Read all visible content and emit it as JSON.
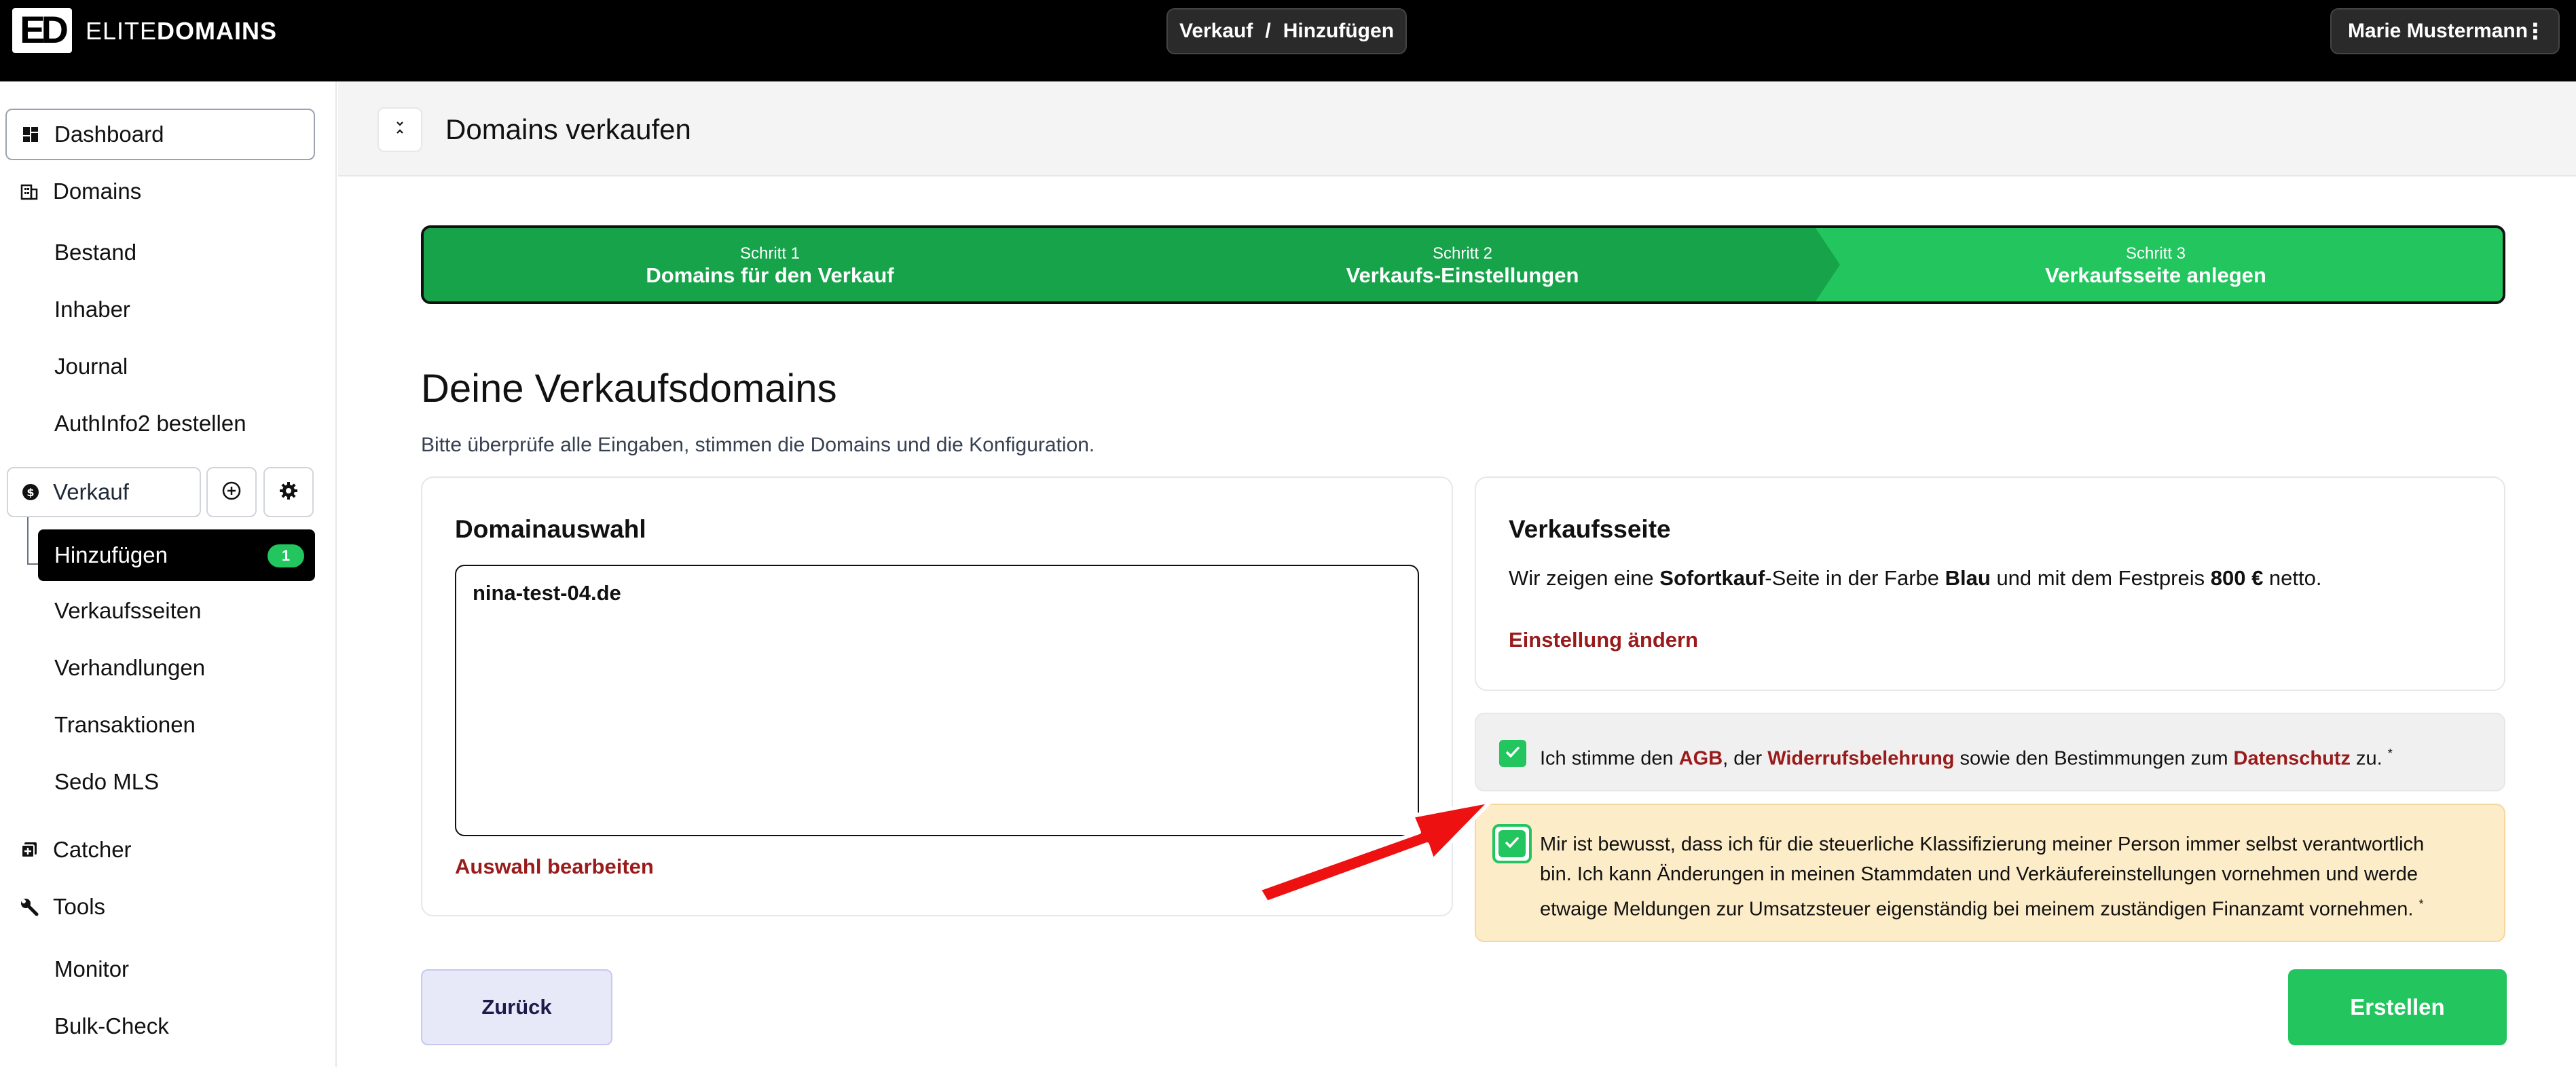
{
  "brand": {
    "mark": "ED",
    "name_light": "ELITE",
    "name_bold": "DOMAINS"
  },
  "breadcrumb": {
    "part1": "Verkauf",
    "separator": "/",
    "part2": "Hinzufügen"
  },
  "user": {
    "name": "Marie Mustermann",
    "menu_icon": "vertical-dots-icon"
  },
  "sidebar": {
    "dashboard": "Dashboard",
    "domains": "Domains",
    "domain_items": [
      "Bestand",
      "Inhaber",
      "Journal",
      "AuthInfo2 bestellen"
    ],
    "verkauf": "Verkauf",
    "add_active": "Hinzufügen",
    "add_badge": "1",
    "verkauf_items": [
      "Verkaufsseiten",
      "Verhandlungen",
      "Transaktionen",
      "Sedo MLS"
    ],
    "catcher": "Catcher",
    "tools": "Tools",
    "tool_items": [
      "Monitor",
      "Bulk-Check"
    ]
  },
  "page": {
    "title": "Domains verkaufen"
  },
  "stepper": {
    "steps": [
      {
        "number": "Schritt 1",
        "label": "Domains für den Verkauf"
      },
      {
        "number": "Schritt 2",
        "label": "Verkaufs-Einstellungen"
      },
      {
        "number": "Schritt 3",
        "label": "Verkaufsseite anlegen"
      }
    ],
    "done_color": "#16a34a",
    "active_color": "#22c55e"
  },
  "main": {
    "heading": "Deine Verkaufsdomains",
    "subheading": "Bitte überprüfe alle Eingaben, stimmen die Domains und die Konfiguration."
  },
  "domain_card": {
    "title": "Domainauswahl",
    "domain": "nina-test-04.de",
    "edit_link": "Auswahl bearbeiten"
  },
  "sales_card": {
    "title": "Verkaufsseite",
    "text_1": "Wir zeigen eine ",
    "type": "Sofortkauf",
    "text_2": "-Seite in der Farbe ",
    "color": "Blau",
    "text_3": " und mit dem Festpreis ",
    "price": "800 €",
    "text_4": " netto.",
    "change_link": "Einstellung ändern"
  },
  "agreement": {
    "t1": "Ich stimme den ",
    "agb": "AGB",
    "t2": ", der ",
    "widerruf": "Widerrufsbelehrung",
    "t3": " sowie den Bestimmungen zum ",
    "datenschutz": "Datenschutz",
    "t4": " zu.",
    "required": "*",
    "checked": true
  },
  "tax_notice": {
    "line1": "Mir ist bewusst, dass ich für die steuerliche Klassifizierung meiner Person immer selbst verantwortlich",
    "line2": "bin. Ich kann Änderungen in meinen Stammdaten und Verkäufereinstellungen vornehmen und werde",
    "line3": "etwaige Meldungen zur Umsatzsteuer eigenständig bei meinem zuständigen Finanzamt vornehmen.",
    "required": "*",
    "checked": true
  },
  "buttons": {
    "back": "Zurück",
    "create": "Erstellen"
  },
  "colors": {
    "accent_green": "#22c55e",
    "link_red": "#991b1b",
    "warning_bg": "#fcecc8",
    "arrow_red": "#ee1111"
  }
}
